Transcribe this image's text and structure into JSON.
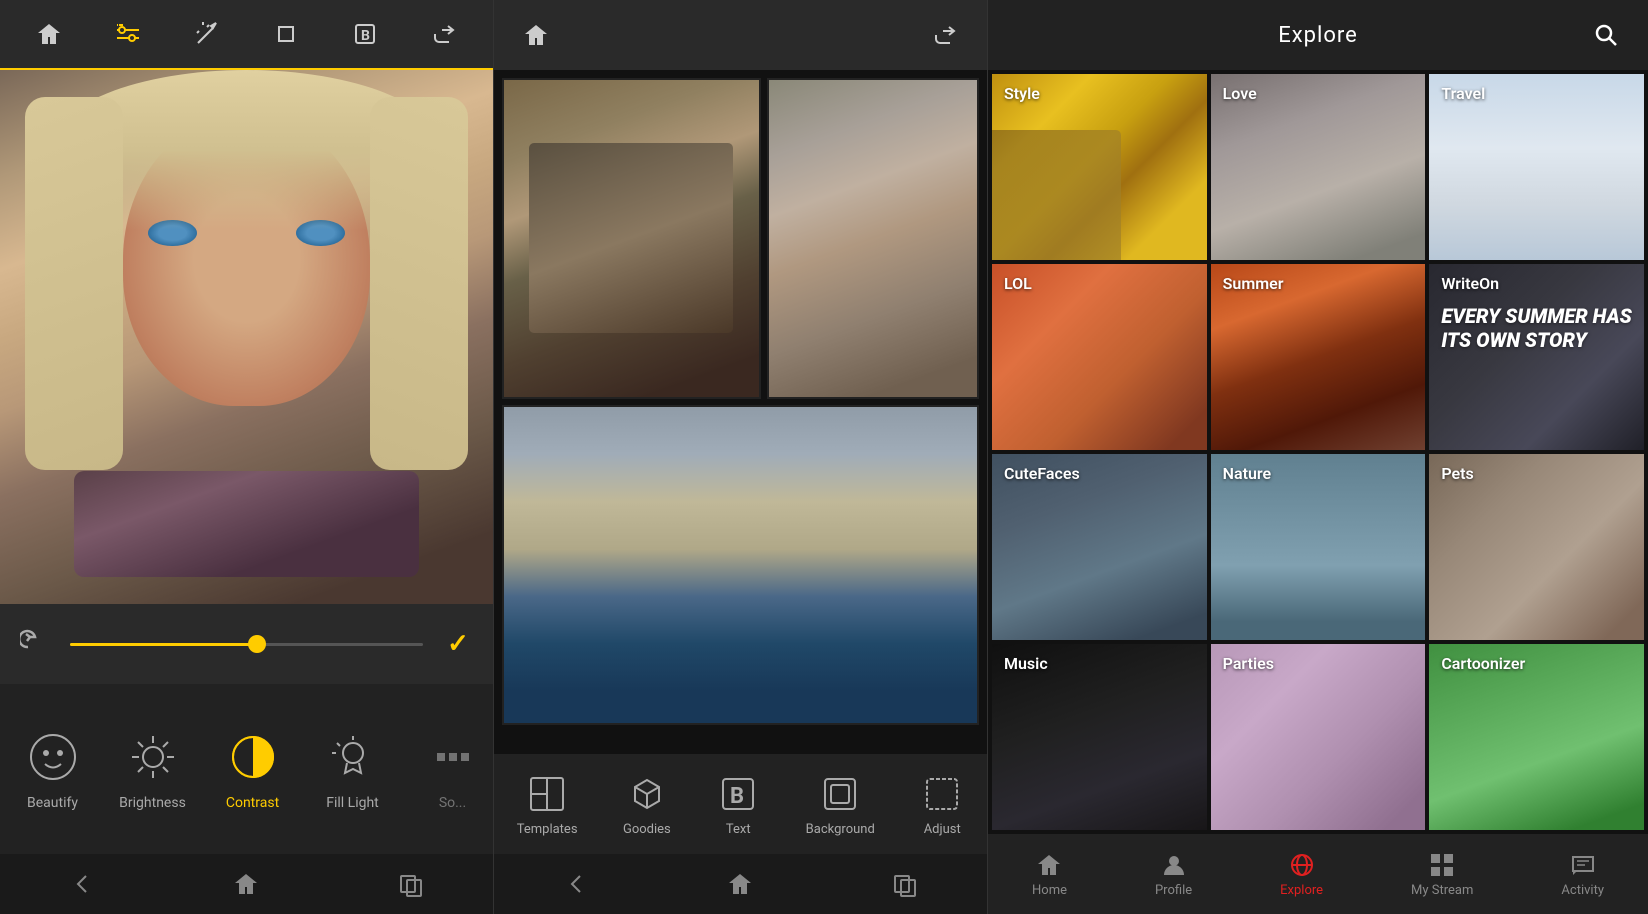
{
  "panel1": {
    "toolbar": {
      "home_label": "Home",
      "adjust_label": "Adjust",
      "magic_label": "Magic",
      "crop_label": "Crop",
      "text_label": "Text",
      "share_label": "Share"
    },
    "tools": [
      {
        "id": "beautify",
        "label": "Beautify",
        "icon": "☺",
        "active": false
      },
      {
        "id": "brightness",
        "label": "Brightness",
        "icon": "☀",
        "active": false
      },
      {
        "id": "contrast",
        "label": "Contrast",
        "icon": "◑",
        "active": true
      },
      {
        "id": "fill-light",
        "label": "Fill Light",
        "icon": "💡",
        "active": false
      },
      {
        "id": "so",
        "label": "So...",
        "icon": "◈",
        "active": false
      }
    ],
    "nav": [
      "←",
      "⌂",
      "▭"
    ]
  },
  "panel2": {
    "toolbar": {
      "home_label": "Home",
      "share_label": "Share"
    },
    "tools": [
      {
        "id": "templates",
        "label": "Templates",
        "icon": "▦"
      },
      {
        "id": "goodies",
        "label": "Goodies",
        "icon": "⬡"
      },
      {
        "id": "text",
        "label": "Text",
        "icon": "B"
      },
      {
        "id": "background",
        "label": "Background",
        "icon": "⬚"
      },
      {
        "id": "adjust",
        "label": "Adjust",
        "icon": "⬜"
      }
    ],
    "nav": [
      "←",
      "⌂",
      "▭"
    ]
  },
  "panel3": {
    "header": {
      "title": "Explore",
      "search_label": "Search"
    },
    "grid": [
      {
        "id": "style",
        "label": "Style",
        "bg": "style"
      },
      {
        "id": "love",
        "label": "Love",
        "bg": "love"
      },
      {
        "id": "travel",
        "label": "Travel",
        "bg": "travel"
      },
      {
        "id": "lol",
        "label": "LOL",
        "bg": "lol"
      },
      {
        "id": "summer",
        "label": "Summer",
        "bg": "summer"
      },
      {
        "id": "writeon",
        "label": "WriteOn",
        "bg": "writeon",
        "extra_text": "EVERY SUMMER HAS ITS OWN STORY"
      },
      {
        "id": "cutefaces",
        "label": "CuteFaces",
        "bg": "cutefaces"
      },
      {
        "id": "nature",
        "label": "Nature",
        "bg": "nature"
      },
      {
        "id": "pets",
        "label": "Pets",
        "bg": "pets"
      },
      {
        "id": "music",
        "label": "Music",
        "bg": "music"
      },
      {
        "id": "parties",
        "label": "Parties",
        "bg": "parties"
      },
      {
        "id": "cartoonizer",
        "label": "Cartoonizer",
        "bg": "cartoonizer"
      }
    ],
    "nav": [
      {
        "id": "home",
        "label": "Home",
        "icon": "home",
        "active": false
      },
      {
        "id": "profile",
        "label": "Profile",
        "icon": "person",
        "active": false
      },
      {
        "id": "explore",
        "label": "Explore",
        "icon": "globe",
        "active": true
      },
      {
        "id": "mystream",
        "label": "My Stream",
        "icon": "grid",
        "active": false
      },
      {
        "id": "activity",
        "label": "Activity",
        "icon": "chat",
        "active": false
      }
    ]
  }
}
